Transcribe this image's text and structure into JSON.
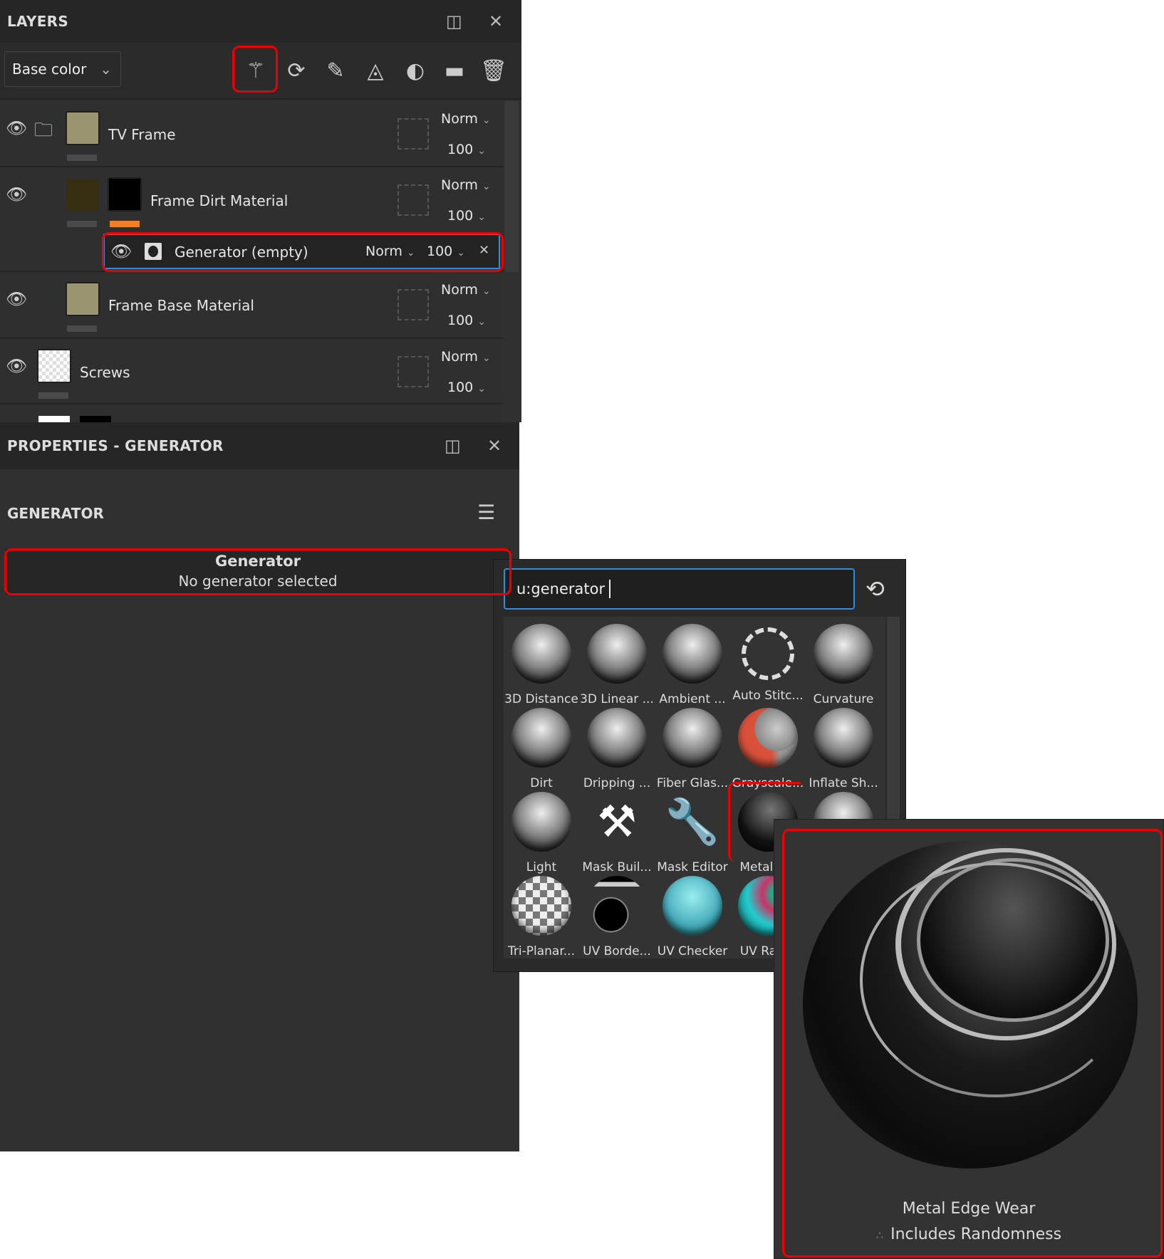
{
  "layers": {
    "title": "LAYERS",
    "channel_select": "Base color",
    "toolbar_icons": [
      "magic-wand-icon",
      "mask-refresh-icon",
      "paint-brush-icon",
      "fill-bucket-icon",
      "smart-mask-icon",
      "folder-icon",
      "trash-icon"
    ],
    "rows": [
      {
        "name": "TV Frame",
        "blend": "Norm",
        "opacity": "100"
      },
      {
        "name": "Frame Dirt Material",
        "blend": "Norm",
        "opacity": "100"
      },
      {
        "name": "Frame Base Material",
        "blend": "Norm",
        "opacity": "100"
      },
      {
        "name": "Screws",
        "blend": "Norm",
        "opacity": "100"
      }
    ],
    "sub_row": {
      "name": "Generator (empty)",
      "blend": "Norm",
      "opacity": "100"
    },
    "colors": {
      "tv_frame_thumb": "#9a9470",
      "dirt_thumb": "#372e10",
      "accent_bar": "#f08020",
      "selection": "#2f8de0"
    }
  },
  "properties": {
    "title": "PROPERTIES - GENERATOR",
    "section": "GENERATOR",
    "box_title": "Generator",
    "box_subtitle": "No generator selected"
  },
  "picker": {
    "search_value": "u:generator",
    "items": [
      "3D Distance",
      "3D Linear ...",
      "Ambient ...",
      "Auto Stitc...",
      "Curvature",
      "Dirt",
      "Dripping ...",
      "Fiber Glas...",
      "Grayscale...",
      "Inflate Sh...",
      "Light",
      "Mask Buil...",
      "Mask Editor",
      "Metal E...",
      "",
      "Tri-Planar...",
      "UV Borde...",
      "UV Checker",
      "UV Ran..."
    ]
  },
  "tooltip": {
    "title": "Metal Edge Wear",
    "note": "Includes Randomness"
  },
  "highlight_color": "#e00000"
}
